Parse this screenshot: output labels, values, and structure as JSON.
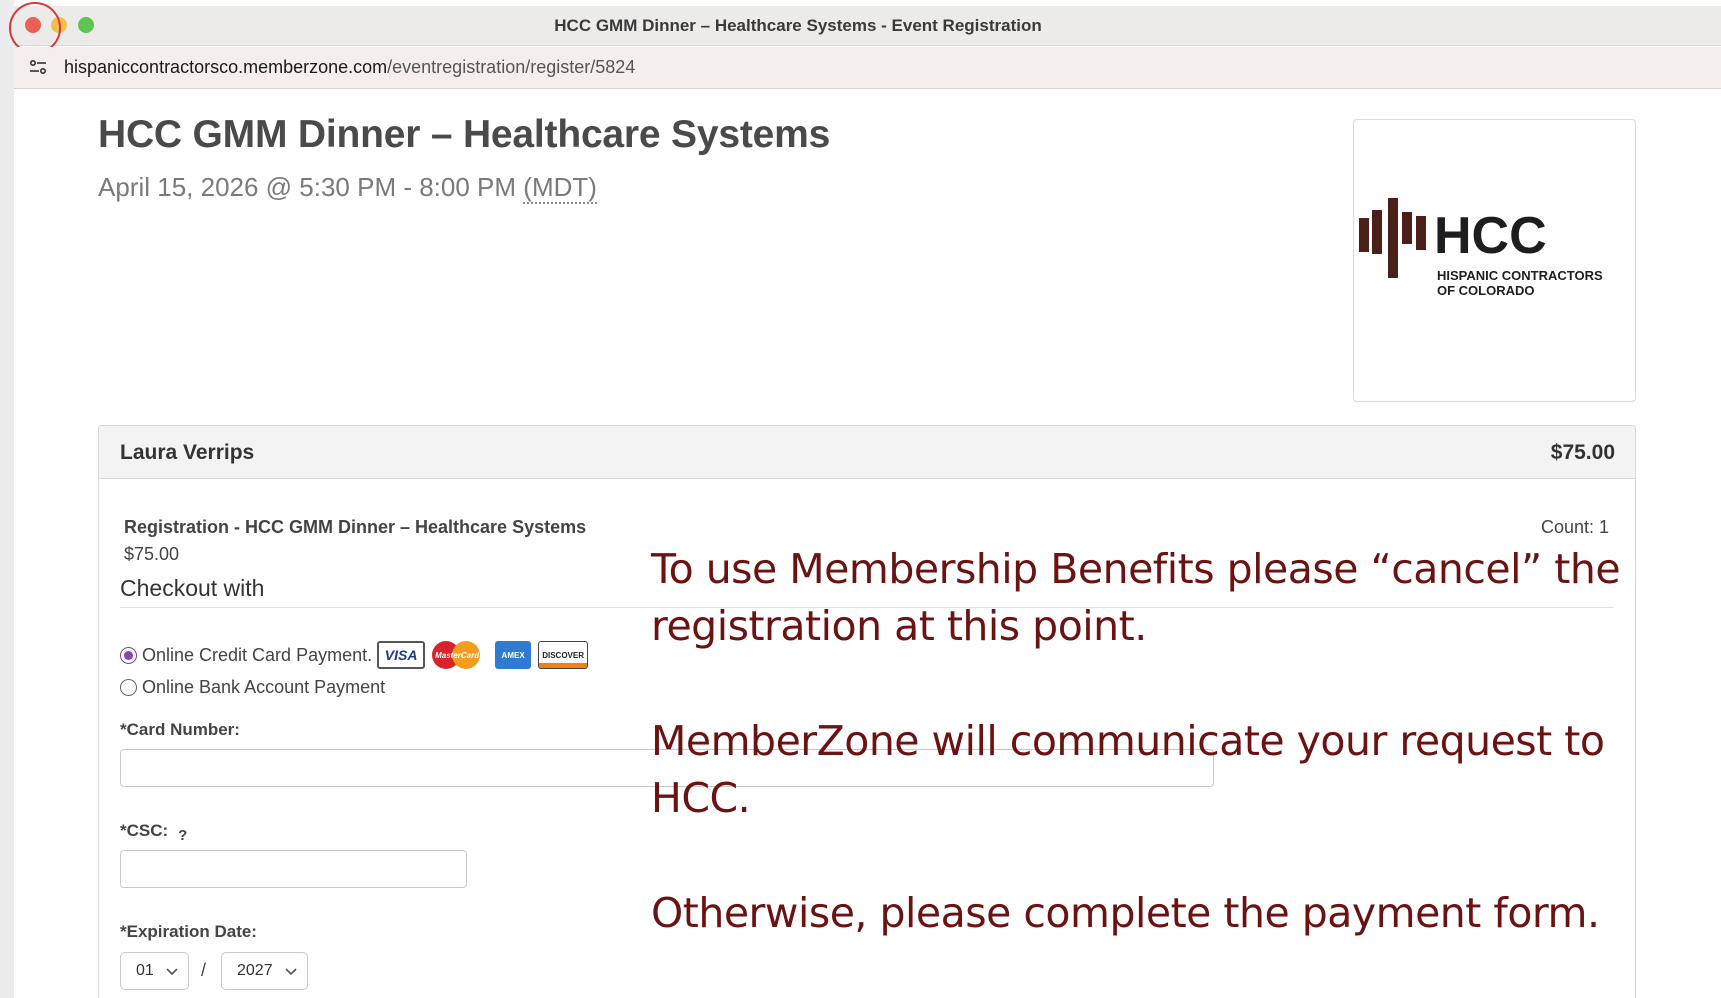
{
  "window": {
    "title": "HCC GMM Dinner – Healthcare Systems - Event Registration"
  },
  "address_bar": {
    "host": "hispaniccontractorsco.memberzone.com",
    "path": "/eventregistration/register/5824"
  },
  "event": {
    "title": "HCC GMM Dinner – Healthcare Systems",
    "date_text": "April 15, 2026 @ 5:30 PM - 8:00 PM ",
    "timezone": "(MDT)"
  },
  "logo": {
    "wordmark": "HCC",
    "line1": "HISPANIC CONTRACTORS",
    "line2": "OF COLORADO",
    "colors": {
      "bars": "#4a2019",
      "text": "#1e1e1e"
    }
  },
  "registrant": {
    "name": "Laura Verrips",
    "total": "$75.00"
  },
  "line_item": {
    "title": "Registration - HCC GMM Dinner – Healthcare Systems",
    "price": "$75.00",
    "count": "Count: 1"
  },
  "checkout": {
    "label": "Checkout with",
    "options": [
      {
        "label": "Online Credit Card Payment.",
        "selected": true
      },
      {
        "label": "Online Bank Account Payment",
        "selected": false
      }
    ],
    "card_logos": [
      "VISA",
      "MasterCard",
      "AMEX",
      "DISCOVER"
    ]
  },
  "form": {
    "card_number_label": "*Card Number:",
    "csc_label": "*CSC:",
    "csc_help": "?",
    "expiration_label": "*Expiration Date:",
    "exp_month": "01",
    "exp_separator": "/",
    "exp_year": "2027"
  },
  "annotation": {
    "line1": "To use Membership Benefits please “cancel” the",
    "line2": "registration at this point.",
    "line3": "MemberZone will communicate your request to",
    "line4": "HCC.",
    "line5": "Otherwise, please complete the payment form.",
    "color": "#6b1212"
  },
  "colors": {
    "accent_radio": "#8b44b8",
    "highlight_ring": "#d53a3a"
  }
}
